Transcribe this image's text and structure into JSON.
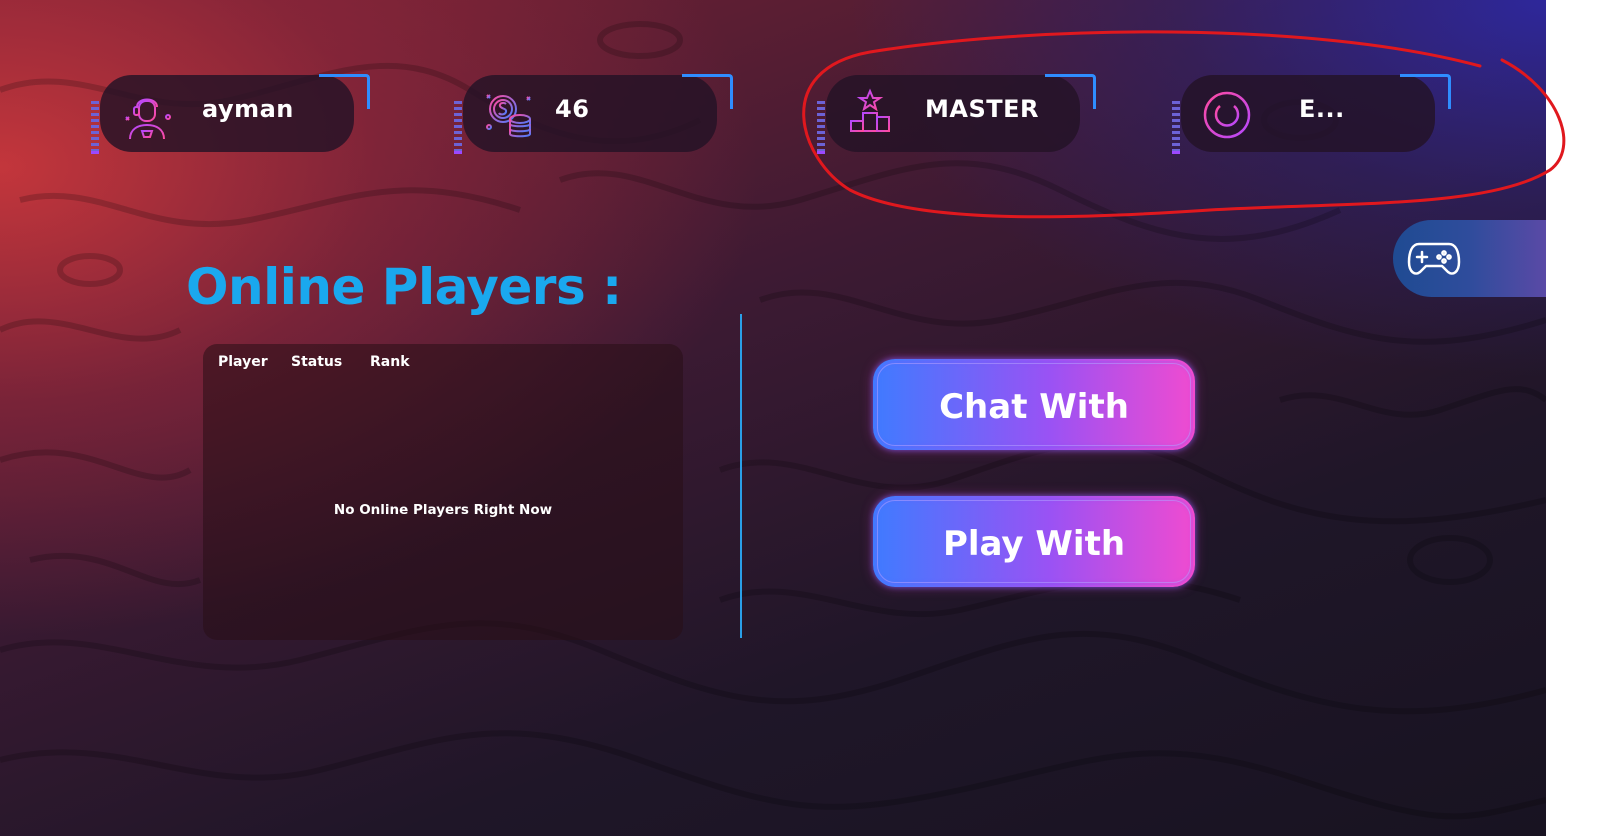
{
  "stats": {
    "username": "ayman",
    "coins": "46",
    "rank": "MASTER",
    "logout_label": "E..."
  },
  "icons": {
    "user": "user-headset-icon",
    "coins": "coins-icon",
    "rank": "podium-star-icon",
    "power": "power-icon",
    "gamepad": "gamepad-icon"
  },
  "online_players": {
    "title": "Online Players :",
    "columns": [
      "Player",
      "Status",
      "Rank"
    ],
    "empty_message": "No Online Players Right Now"
  },
  "actions": {
    "chat_with": "Chat With",
    "play_with": "Play With"
  },
  "colors": {
    "accent_blue": "#1aa8ee",
    "neon_blue": "#3f7bff",
    "neon_pink": "#f04bd0",
    "annotation_red": "#e0181e"
  }
}
